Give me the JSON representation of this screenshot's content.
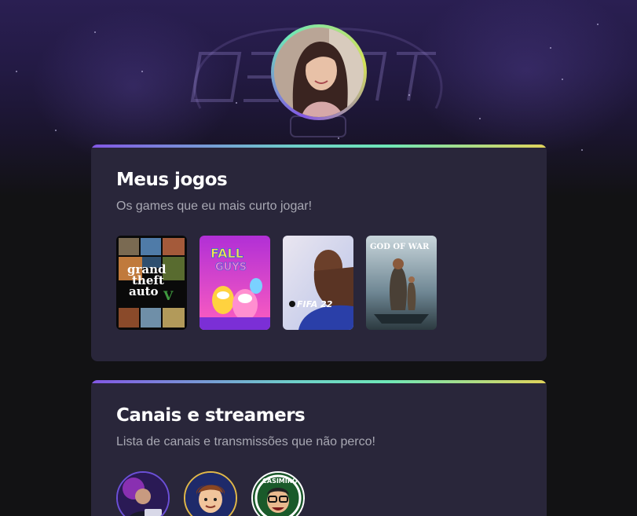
{
  "profile": {
    "avatar": "user-avatar-photo"
  },
  "games_section": {
    "title": "Meus jogos",
    "subtitle": "Os games que eu mais curto jogar!",
    "games": [
      {
        "icon": "gta-v-cover",
        "cover_text": [
          "grand",
          "theft",
          "auto",
          "V"
        ]
      },
      {
        "icon": "fall-guys-cover",
        "cover_text": [
          "FALL",
          "GUYS"
        ]
      },
      {
        "icon": "fifa-22-cover",
        "cover_text": [
          "FIFA 22"
        ]
      },
      {
        "icon": "god-of-war-cover",
        "cover_text": [
          "GOD OF WAR"
        ]
      }
    ]
  },
  "streams_section": {
    "title": "Canais e streamers",
    "subtitle": "Lista de canais e transmissões que não perco!",
    "channels": [
      {
        "icon": "streamer-1-avatar"
      },
      {
        "icon": "streamer-2-avatar"
      },
      {
        "icon": "casimiro-avatar",
        "badge_text": "CASIMIRO"
      }
    ]
  },
  "colors": {
    "background": "#121214",
    "card": "#29263a",
    "accent_gradient": [
      "#8257e5",
      "#6ee7b7",
      "#e1d35a"
    ]
  }
}
